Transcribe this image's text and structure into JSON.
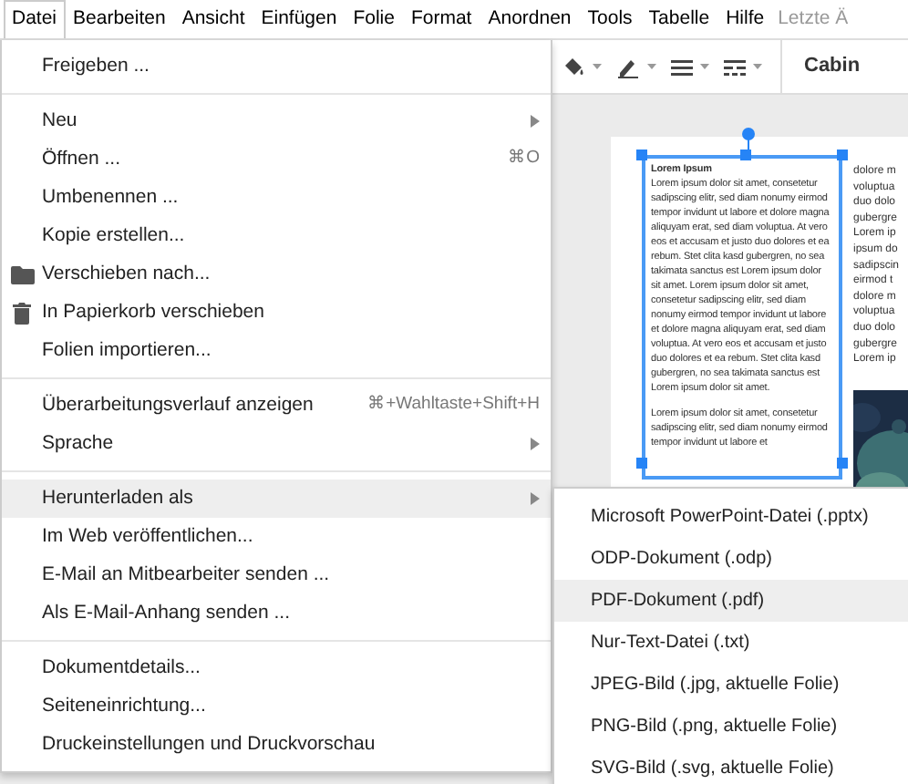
{
  "menubar": [
    {
      "label": "Datei",
      "selected": true
    },
    {
      "label": "Bearbeiten",
      "selected": false
    },
    {
      "label": "Ansicht",
      "selected": false
    },
    {
      "label": "Einfügen",
      "selected": false
    },
    {
      "label": "Folie",
      "selected": false
    },
    {
      "label": "Format",
      "selected": false
    },
    {
      "label": "Anordnen",
      "selected": false
    },
    {
      "label": "Tools",
      "selected": false
    },
    {
      "label": "Tabelle",
      "selected": false
    },
    {
      "label": "Hilfe",
      "selected": false
    }
  ],
  "last_edit": "Letzte Ä",
  "toolbar": {
    "font": "Cabin"
  },
  "slide": {
    "title": "Lorem Ipsum",
    "paragraphs": [
      "Lorem ipsum dolor sit amet, consetetur sadipscing elitr, sed diam nonumy eirmod tempor invidunt ut labore et dolore magna aliquyam erat, sed diam voluptua. At vero eos et accusam et justo duo dolores et ea rebum. Stet clita kasd gubergren, no sea takimata sanctus est Lorem ipsum dolor sit amet. Lorem ipsum dolor sit amet, consetetur sadipscing elitr, sed diam nonumy eirmod tempor invidunt ut labore et dolore magna aliquyam erat, sed diam voluptua. At vero eos et accusam et justo duo dolores et ea rebum. Stet clita kasd gubergren, no sea takimata sanctus est Lorem ipsum dolor sit amet.",
      "Lorem ipsum dolor sit amet, consetetur sadipscing elitr, sed diam nonumy eirmod tempor invidunt ut labore et"
    ],
    "column_2": [
      "dolore m",
      "voluptua",
      "duo dolo",
      "gubergre",
      "Lorem ip",
      "ipsum do",
      "sadipscin",
      "eirmod t",
      "dolore m",
      "voluptua",
      "duo dolo",
      "gubergre",
      "Lorem ip"
    ]
  },
  "menu": [
    {
      "kind": "item",
      "label": "Freigeben ...",
      "selected": false
    },
    {
      "kind": "divider"
    },
    {
      "kind": "item",
      "label": "Neu",
      "submenu": true,
      "selected": false
    },
    {
      "kind": "item",
      "label": "Öffnen ...",
      "shortcut": "⌘O",
      "selected": false
    },
    {
      "kind": "item",
      "label": "Umbenennen ...",
      "selected": false
    },
    {
      "kind": "item",
      "label": "Kopie erstellen...",
      "selected": false
    },
    {
      "kind": "move",
      "label": "Verschieben nach...",
      "selected": false
    },
    {
      "kind": "trash",
      "label": "In Papierkorb verschieben",
      "selected": false
    },
    {
      "kind": "item",
      "label": "Folien importieren...",
      "selected": false
    },
    {
      "kind": "divider"
    },
    {
      "kind": "item",
      "label": "Überarbeitungsverlauf anzeigen",
      "shortcut": "⌘+Wahltaste+Shift+H",
      "selected": false
    },
    {
      "kind": "item",
      "label": "Sprache",
      "submenu": true,
      "selected": false
    },
    {
      "kind": "divider"
    },
    {
      "kind": "item",
      "label": "Herunterladen als",
      "submenu": true,
      "selected": true
    },
    {
      "kind": "item",
      "label": "Im Web veröffentlichen...",
      "selected": false
    },
    {
      "kind": "item",
      "label": "E-Mail an Mitbearbeiter senden ...",
      "selected": false
    },
    {
      "kind": "item",
      "label": "Als E-Mail-Anhang senden ...",
      "selected": false
    },
    {
      "kind": "divider"
    },
    {
      "kind": "item",
      "label": "Dokumentdetails...",
      "selected": false
    },
    {
      "kind": "item",
      "label": "Seiteneinrichtung...",
      "selected": false
    },
    {
      "kind": "item",
      "label": "Druckeinstellungen und Druckvorschau",
      "selected": false
    }
  ],
  "submenu": [
    {
      "label": "Microsoft PowerPoint-Datei (.pptx)",
      "selected": false
    },
    {
      "label": "ODP-Dokument (.odp)",
      "selected": false
    },
    {
      "label": "PDF-Dokument (.pdf)",
      "selected": true
    },
    {
      "label": "Nur-Text-Datei (.txt)",
      "selected": false
    },
    {
      "label": "JPEG-Bild (.jpg, aktuelle Folie)",
      "selected": false
    },
    {
      "label": "PNG-Bild (.png, aktuelle Folie)",
      "selected": false
    },
    {
      "label": "SVG-Bild (.svg, aktuelle Folie)",
      "selected": false
    }
  ]
}
